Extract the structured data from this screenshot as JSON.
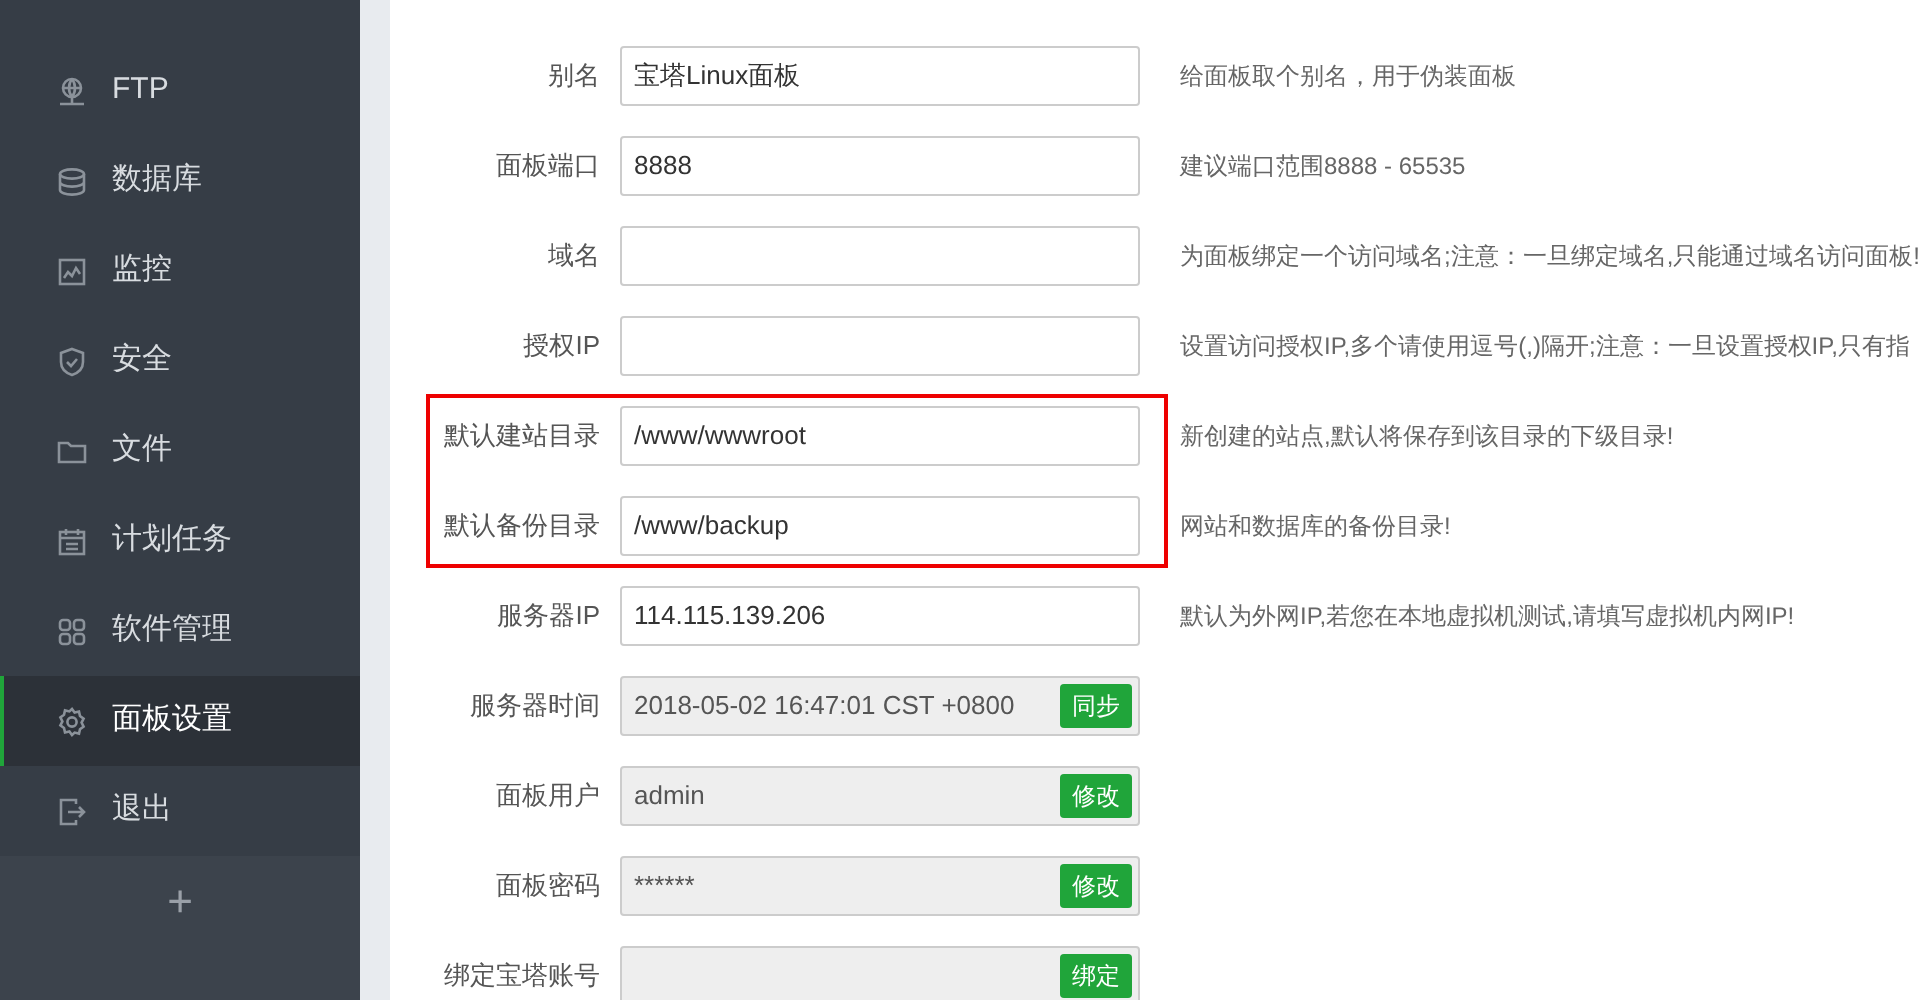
{
  "sidebar": {
    "items": [
      {
        "label": "FTP",
        "kind": "ftp",
        "selected": false
      },
      {
        "label": "数据库",
        "kind": "database",
        "selected": false
      },
      {
        "label": "监控",
        "kind": "monitor",
        "selected": false
      },
      {
        "label": "安全",
        "kind": "shield",
        "selected": false
      },
      {
        "label": "文件",
        "kind": "folder",
        "selected": false
      },
      {
        "label": "计划任务",
        "kind": "calendar",
        "selected": false
      },
      {
        "label": "软件管理",
        "kind": "grid",
        "selected": false
      },
      {
        "label": "面板设置",
        "kind": "gear",
        "selected": true
      },
      {
        "label": "退出",
        "kind": "logout",
        "selected": false
      }
    ],
    "add_button": "+"
  },
  "form": {
    "rows": [
      {
        "label": "别名",
        "kind": "input",
        "value": "宝塔Linux面板",
        "hint": "给面板取个别名，用于伪装面板",
        "highlighted": false
      },
      {
        "label": "面板端口",
        "kind": "input",
        "value": "8888",
        "hint": "建议端口范围8888 - 65535",
        "highlighted": false
      },
      {
        "label": "域名",
        "kind": "input",
        "hint": "为面板绑定一个访问域名;注意：一旦绑定域名,只能通过域名访问面板!",
        "highlighted": false
      },
      {
        "label": "授权IP",
        "kind": "input",
        "hint": "设置访问授权IP,多个请使用逗号(,)隔开;注意：一旦设置授权IP,只有指",
        "highlighted": false
      },
      {
        "label": "默认建站目录",
        "kind": "input",
        "value": "/www/wwwroot",
        "hint": "新创建的站点,默认将保存到该目录的下级目录!",
        "highlighted": true
      },
      {
        "label": "默认备份目录",
        "kind": "input",
        "value": "/www/backup",
        "hint": "网站和数据库的备份目录!",
        "highlighted": true
      },
      {
        "label": "服务器IP",
        "kind": "input",
        "value": "114.115.139.206",
        "hint": "默认为外网IP,若您在本地虚拟机测试,请填写虚拟机内网IP!",
        "highlighted": false
      },
      {
        "label": "服务器时间",
        "kind": "readonly",
        "value": "2018-05-02 16:47:01 CST +0800",
        "button": "同步",
        "highlighted": false
      },
      {
        "label": "面板用户",
        "kind": "readonly",
        "value": "admin",
        "button": "修改",
        "highlighted": false
      },
      {
        "label": "面板密码",
        "kind": "readonly",
        "value": "******",
        "button": "修改",
        "highlighted": false
      },
      {
        "label": "绑定宝塔账号",
        "kind": "readonly",
        "button": "绑定",
        "highlighted": false
      }
    ]
  }
}
